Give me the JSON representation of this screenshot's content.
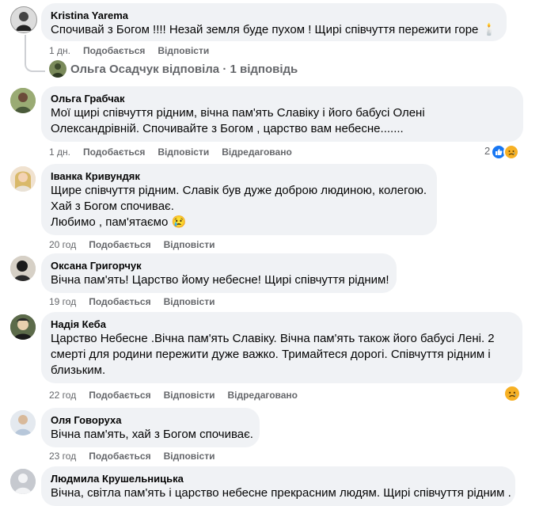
{
  "comments": [
    {
      "author": "Kristina Yarema",
      "lines": [
        "Спочивай з Богом !!!! Незай земля буде пухом ! Щирі співчуття пережити горе 🕯️"
      ],
      "time": "1 дн.",
      "like": "Подобається",
      "reply": "Відповісти",
      "replies_summary": "Ольга Осадчук відповіла · 1 відповідь"
    },
    {
      "author": "Ольга Грабчак",
      "lines": [
        "Мої щирі співчуття рідним, вічна пам'ять Славіку і його бабусі Олені",
        "Олександрівній. Спочивайте з Богом , царство вам небесне......."
      ],
      "time": "1 дн.",
      "like": "Подобається",
      "reply": "Відповісти",
      "edited": "Відредаговано",
      "reaction_count": "2"
    },
    {
      "author": "Іванка Кривундяк",
      "lines": [
        "Щире співчуття рідним. Славік був дуже доброю людиною, колегою.",
        "Хай з Богом спочиває.",
        "Любимо , пам'ятаємо 😢"
      ],
      "time": "20 год",
      "like": "Подобається",
      "reply": "Відповісти"
    },
    {
      "author": "Оксана Григорчук",
      "lines": [
        "Вічна пам'ять! Царство йому небесне! Щирі співчуття рідним!"
      ],
      "time": "19 год",
      "like": "Подобається",
      "reply": "Відповісти"
    },
    {
      "author": "Надія Кеба",
      "lines": [
        "Царство Небесне .Вічна пам'ять Славіку. Вічна пам'ять також його бабусі Лені. 2",
        "смерті для родини пережити дуже важко. Тримайтеся дорогі. Співчуття рідним і",
        "близьким."
      ],
      "time": "22 год",
      "like": "Подобається",
      "reply": "Відповісти",
      "edited": "Відредаговано"
    },
    {
      "author": "Оля Говоруха",
      "lines": [
        "Вічна пам'ять, хай з Богом спочиває."
      ],
      "time": "23 год",
      "like": "Подобається",
      "reply": "Відповісти"
    },
    {
      "author": "Людмила Крушельницька",
      "lines": [
        "Вічна, світла пам'ять і царство небесне прекрасним людям. Щирі співчуття рідним ."
      ]
    }
  ],
  "colors": {
    "bubble": "#f0f2f5",
    "meta": "#65676b",
    "like_blue": "#1877f2",
    "sad_yellow": "#f7b125"
  },
  "icons": [
    "thumbs-up-icon",
    "sad-face-icon"
  ]
}
